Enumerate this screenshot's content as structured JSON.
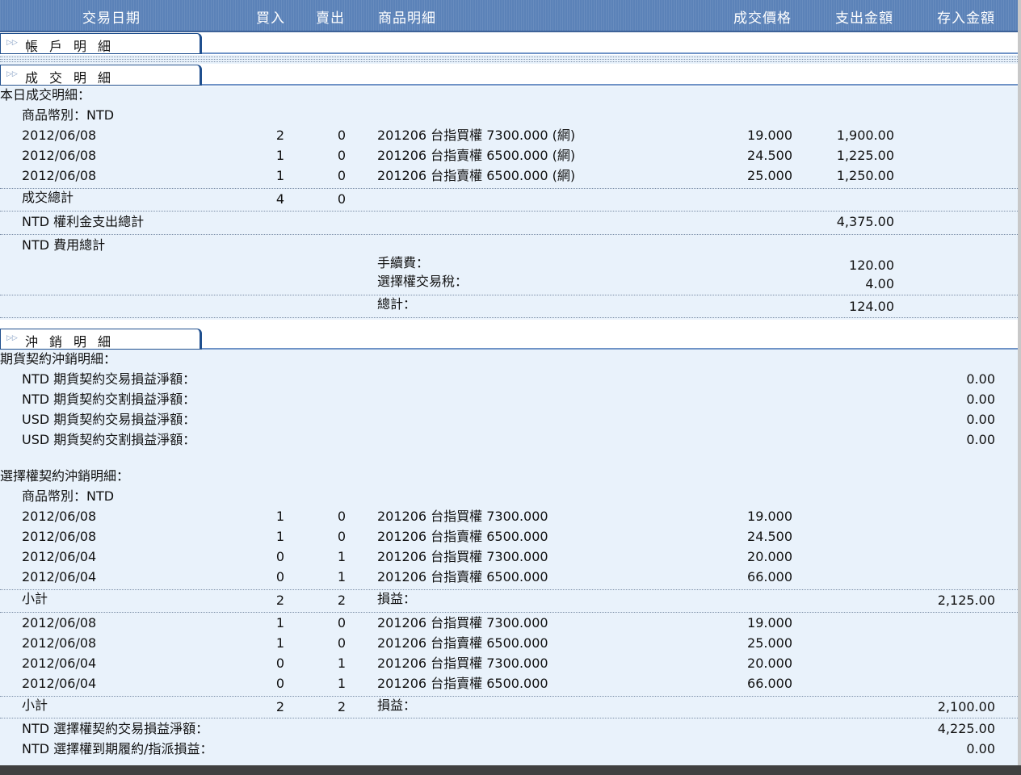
{
  "header": {
    "cols": [
      "交易日期",
      "買入",
      "賣出",
      "商品明細",
      "成交價格",
      "支出金額",
      "存入金額"
    ]
  },
  "tabs": {
    "account": "帳戶明細",
    "trade": "成交明細",
    "offset": "沖銷明細"
  },
  "today": {
    "title": "本日成交明細：",
    "currency": "商品幣別：NTD",
    "rows": [
      {
        "date": "2012/06/08",
        "buy": "2",
        "sell": "0",
        "product": "201206 台指買權 7300.000 (網)",
        "price": "19.000",
        "expense": "1,900.00"
      },
      {
        "date": "2012/06/08",
        "buy": "1",
        "sell": "0",
        "product": "201206 台指賣權 6500.000 (網)",
        "price": "24.500",
        "expense": "1,225.00"
      },
      {
        "date": "2012/06/08",
        "buy": "1",
        "sell": "0",
        "product": "201206 台指賣權 6500.000 (網)",
        "price": "25.000",
        "expense": "1,250.00"
      }
    ],
    "total_label": "成交總計",
    "total_buy": "4",
    "total_sell": "0",
    "premium_label": "NTD 權利金支出總計",
    "premium_value": "4,375.00",
    "fee_label": "NTD 費用總計",
    "fee_items": [
      {
        "label": "手續費：",
        "value": "120.00"
      },
      {
        "label": "選擇權交易稅：",
        "value": "4.00"
      }
    ],
    "fee_total_label": "總計：",
    "fee_total_value": "124.00"
  },
  "futures": {
    "title": "期貨契約沖銷明細：",
    "items": [
      {
        "label": "NTD 期貨契約交易損益淨額：",
        "value": "0.00"
      },
      {
        "label": "NTD 期貨契約交割損益淨額：",
        "value": "0.00"
      },
      {
        "label": "USD 期貨契約交易損益淨額：",
        "value": "0.00"
      },
      {
        "label": "USD 期貨契約交割損益淨額：",
        "value": "0.00"
      }
    ]
  },
  "options": {
    "title": "選擇權契約沖銷明細：",
    "currency": "商品幣別：NTD",
    "group1": [
      {
        "date": "2012/06/08",
        "buy": "1",
        "sell": "0",
        "product": "201206 台指買權 7300.000",
        "price": "19.000"
      },
      {
        "date": "2012/06/08",
        "buy": "1",
        "sell": "0",
        "product": "201206 台指賣權 6500.000",
        "price": "24.500"
      },
      {
        "date": "2012/06/04",
        "buy": "0",
        "sell": "1",
        "product": "201206 台指買權 7300.000",
        "price": "20.000"
      },
      {
        "date": "2012/06/04",
        "buy": "0",
        "sell": "1",
        "product": "201206 台指賣權 6500.000",
        "price": "66.000"
      }
    ],
    "sub1": {
      "label": "小計",
      "buy": "2",
      "sell": "2",
      "pl_label": "損益：",
      "pl_value": "2,125.00"
    },
    "group2": [
      {
        "date": "2012/06/08",
        "buy": "1",
        "sell": "0",
        "product": "201206 台指買權 7300.000",
        "price": "19.000"
      },
      {
        "date": "2012/06/08",
        "buy": "1",
        "sell": "0",
        "product": "201206 台指賣權 6500.000",
        "price": "25.000"
      },
      {
        "date": "2012/06/04",
        "buy": "0",
        "sell": "1",
        "product": "201206 台指買權 7300.000",
        "price": "20.000"
      },
      {
        "date": "2012/06/04",
        "buy": "0",
        "sell": "1",
        "product": "201206 台指賣權 6500.000",
        "price": "66.000"
      }
    ],
    "sub2": {
      "label": "小計",
      "buy": "2",
      "sell": "2",
      "pl_label": "損益：",
      "pl_value": "2,100.00"
    },
    "net_label": "NTD 選擇權契約交易損益淨額：",
    "net_value": "4,225.00",
    "expiry_label": "NTD 選擇權到期履約/指派損益：",
    "expiry_value": "0.00"
  }
}
